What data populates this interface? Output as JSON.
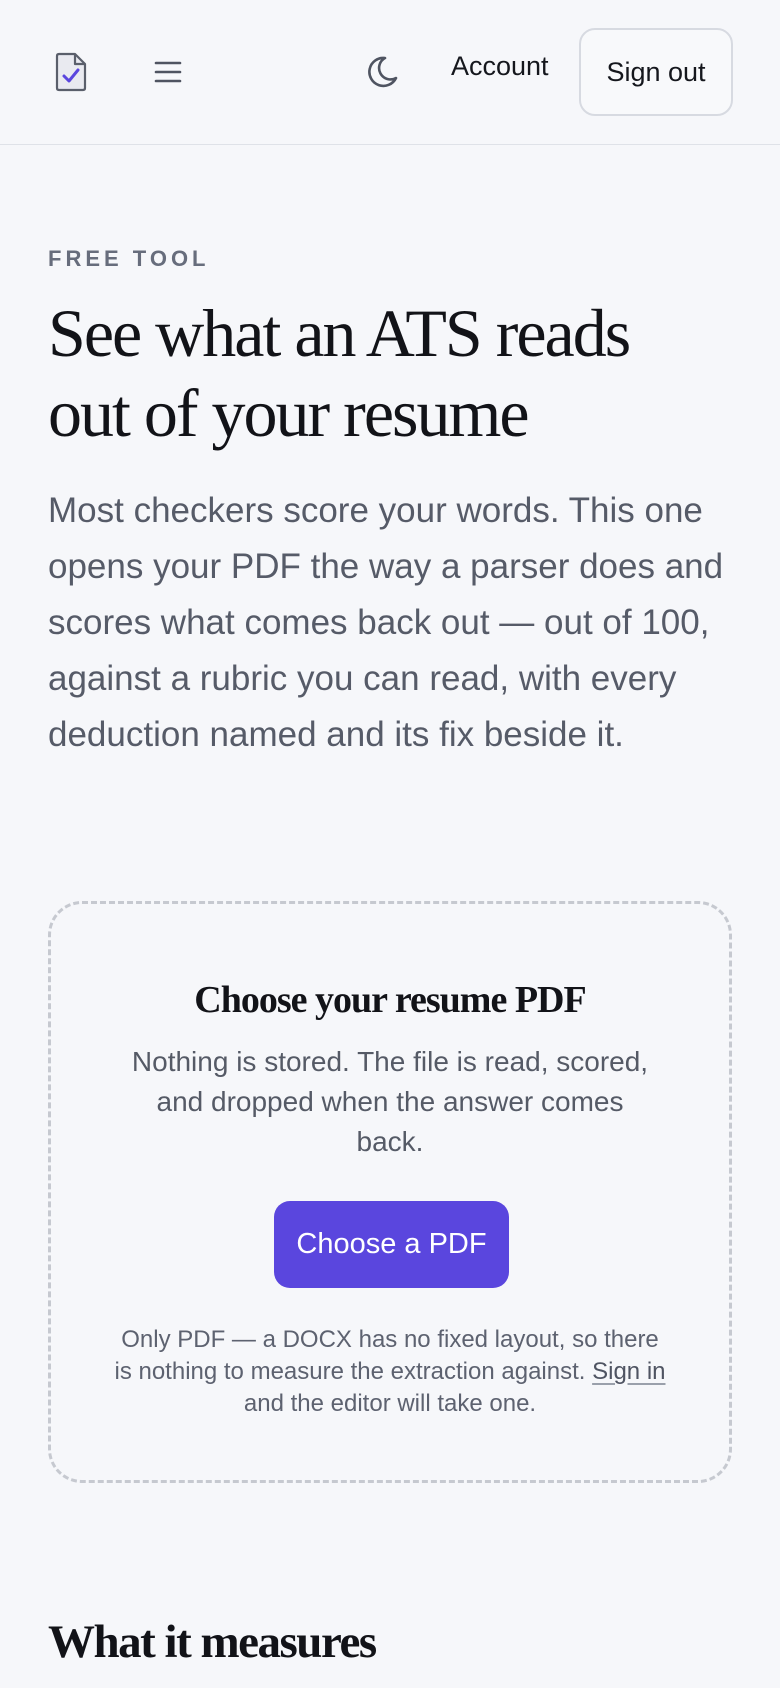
{
  "header": {
    "logo_icon": "resume-check-icon",
    "menu_icon": "hamburger-menu-icon",
    "theme_icon": "moon-icon",
    "account_label": "Account",
    "signout_label": "Sign out"
  },
  "hero": {
    "eyebrow": "FREE TOOL",
    "title_line1": "See what an ATS reads",
    "title_line2": "out of your resume",
    "lede": "Most checkers score your words. This one opens your PDF the way a parser does and scores what comes back out — out of 100, against a rubric you can read, with every deduction named and its fix beside it."
  },
  "upload": {
    "title": "Choose your resume PDF",
    "note": "Nothing is stored. The file is read, scored, and dropped when the answer comes back.",
    "button_label": "Choose a PDF",
    "footnote_before": "Only PDF — a DOCX has no fixed layout, so there is nothing to measure the extraction against.",
    "signin_label": "Sign in",
    "footnote_after": "and the editor will take one."
  },
  "section": {
    "title": "What it measures"
  },
  "colors": {
    "accent": "#5a46de",
    "background": "#f6f7fa",
    "text": "#121318",
    "muted_text": "#565b68"
  }
}
